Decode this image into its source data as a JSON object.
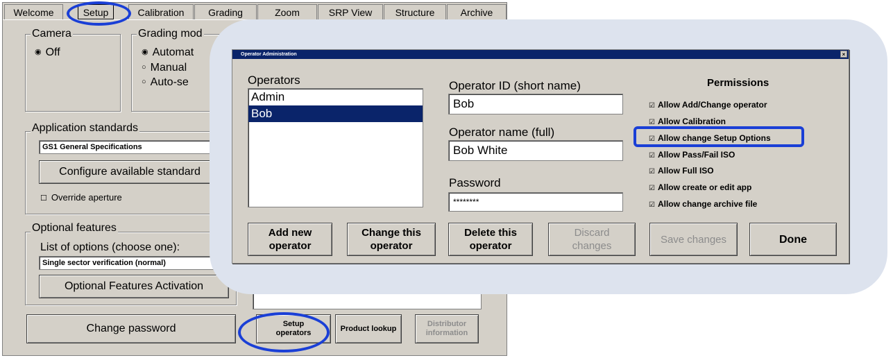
{
  "tabs": [
    "Welcome",
    "Setup",
    "Calibration",
    "Grading",
    "Zoom",
    "SRP View",
    "Structure",
    "Archive"
  ],
  "camera": {
    "title": "Camera",
    "option": "Off"
  },
  "grading": {
    "title": "Grading mod",
    "options": [
      "Automat",
      "Manual",
      "Auto-se"
    ]
  },
  "app_standards": {
    "title": "Application standards",
    "selected": "GS1 General Specifications",
    "configure_label": "Configure available standard",
    "override_label": "Override aperture"
  },
  "optional": {
    "title": "Optional features",
    "list_label": "List of options (choose one):",
    "selected": "Single sector verification (normal)",
    "activation_label": "Optional Features Activation"
  },
  "bottom_buttons": {
    "change_password": "Change password",
    "setup_operators": [
      "Setup",
      "operators"
    ],
    "product_lookup": "Product lookup",
    "distributor_info": [
      "Distributor",
      "information"
    ]
  },
  "dialog": {
    "title": "Operator Administration",
    "close": "×",
    "operators_label": "Operators",
    "operators": [
      "Admin",
      "Bob"
    ],
    "operator_id_label": "Operator ID (short name)",
    "operator_id": "Bob",
    "operator_name_label": "Operator name (full)",
    "operator_name": "Bob White",
    "password_label": "Password",
    "password": "********",
    "permissions_title": "Permissions",
    "permissions": [
      "Allow Add/Change operator",
      "Allow Calibration",
      "Allow change Setup Options",
      "Allow Pass/Fail ISO",
      "Allow Full ISO",
      "Allow create or edit app",
      "Allow change archive file"
    ],
    "buttons": {
      "add": [
        "Add new",
        "operator"
      ],
      "change": [
        "Change this",
        "operator"
      ],
      "delete": [
        "Delete this",
        "operator"
      ],
      "discard": [
        "Discard",
        "changes"
      ],
      "save": "Save changes",
      "done": "Done"
    }
  },
  "colors": {
    "highlight": "#1a3fd6",
    "callout": "#dde3ee",
    "titlebar": "#0a246a"
  }
}
